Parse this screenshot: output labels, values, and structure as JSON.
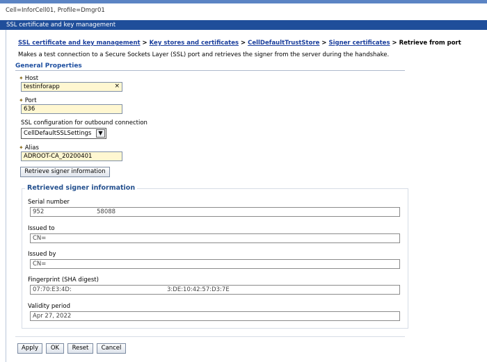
{
  "scope": "Cell=InforCell01, Profile=Dmgr01",
  "title": "SSL certificate and key management",
  "breadcrumb": {
    "items": [
      "SSL certificate and key management",
      "Key stores and certificates",
      "CellDefaultTrustStore",
      "Signer certificates"
    ],
    "current": "Retrieve from port",
    "separator": ">"
  },
  "description": "Makes a test connection to a Secure Sockets Layer (SSL) port and retrieves the signer from the server during the handshake.",
  "general_properties": {
    "heading": "General Properties",
    "host": {
      "label": "Host",
      "value": "testinforapp",
      "clear_icon": "×"
    },
    "port": {
      "label": "Port",
      "value": "636"
    },
    "ssl_config": {
      "label": "SSL configuration for outbound connection",
      "selected": "CellDefaultSSLSettings"
    },
    "alias": {
      "label": "Alias",
      "value": "ADROOT-CA_20200401"
    },
    "retrieve_button": "Retrieve signer information"
  },
  "retrieved": {
    "heading": "Retrieved signer information",
    "serial_number": {
      "label": "Serial number",
      "value_start": "952",
      "value_end": "58088"
    },
    "issued_to": {
      "label": "Issued to",
      "value": "CN="
    },
    "issued_by": {
      "label": "Issued by",
      "value": "CN="
    },
    "fingerprint": {
      "label": "Fingerprint (SHA digest)",
      "value_start": "07:70:E3:4D:",
      "value_end": "3:DE:10:42:57:D3:7E"
    },
    "validity": {
      "label": "Validity period",
      "value": "Apr 27, 2022"
    }
  },
  "buttons": {
    "apply": "Apply",
    "ok": "OK",
    "reset": "Reset",
    "cancel": "Cancel"
  },
  "colors": {
    "title_bar": "#1f4e9a",
    "link": "#1a3e9c",
    "required_field": "#fff7d1",
    "section_heading": "#1e4fa0"
  }
}
